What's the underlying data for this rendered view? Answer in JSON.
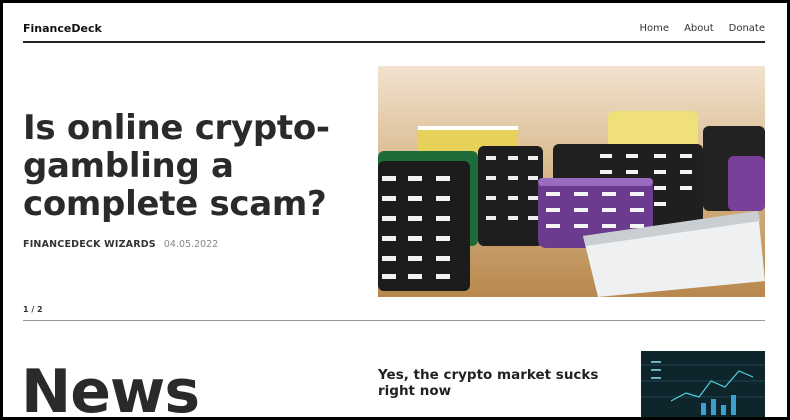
{
  "header": {
    "brand": "FinanceDeck",
    "nav": [
      "Home",
      "About",
      "Donate"
    ]
  },
  "hero": {
    "title": "Is online crypto-gambling a complete scam?",
    "author": "FINANCEDECK WIZARDS",
    "date": "04.05.2022",
    "pager": "1 / 2",
    "image_icon": "casino-chips-photo"
  },
  "news": {
    "heading": "News",
    "article_title": "Yes, the crypto market sucks right now",
    "thumb_icon": "crypto-chart-photo"
  }
}
